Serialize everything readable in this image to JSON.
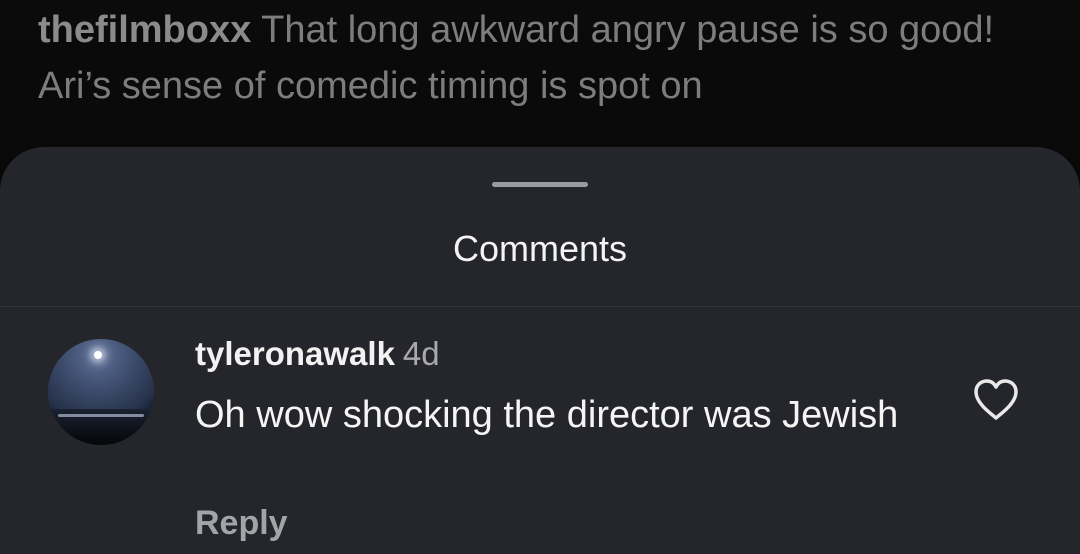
{
  "caption": {
    "username": "thefilmboxx",
    "text": "That long awkward angry pause is so good! Ari’s sense of comedic timing is spot on"
  },
  "sheet": {
    "title": "Comments"
  },
  "comment": {
    "username": "tyleronawalk",
    "time": "4d",
    "text": "Oh wow shocking the director was Jewish",
    "reply_label": "Reply",
    "avatar_icon": "night-moon-avatar",
    "like_icon": "heart-icon"
  },
  "colors": {
    "sheet_background": "#25262b",
    "page_background": "#050505",
    "muted_text": "#a3a4a8",
    "primary_text": "#f5f5f5"
  }
}
